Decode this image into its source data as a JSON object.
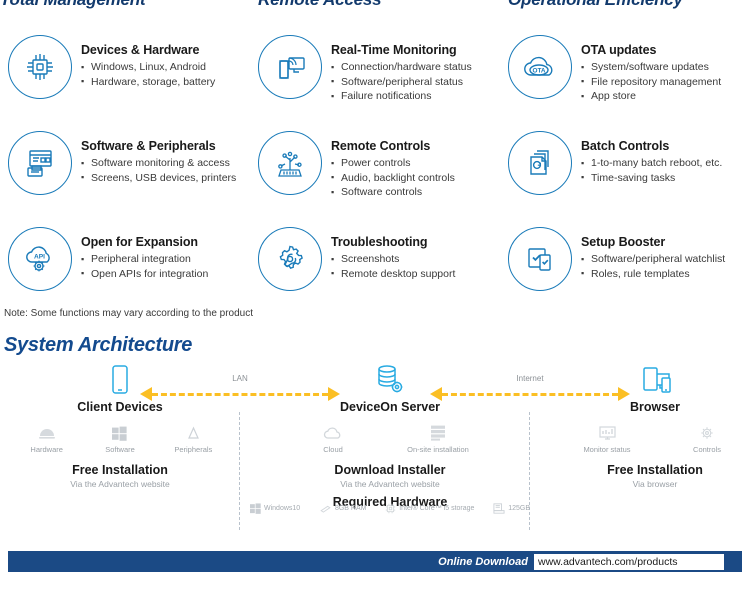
{
  "headers": {
    "col1": "Total Management",
    "col2": "Remote Access",
    "col3": "Operational Efficiency"
  },
  "features": [
    {
      "icon": "cpu-chip-icon",
      "title": "Devices & Hardware",
      "bullets": [
        "Windows, Linux, Android",
        "Hardware, storage, battery"
      ]
    },
    {
      "icon": "real-time-monitor-icon",
      "title": "Real-Time Monitoring",
      "bullets": [
        "Connection/hardware status",
        "Software/peripheral status",
        "Failure notifications"
      ]
    },
    {
      "icon": "ota-cloud-icon",
      "title": "OTA updates",
      "bullets": [
        "System/software updates",
        "File repository management",
        "App store"
      ]
    },
    {
      "icon": "software-peripherals-icon",
      "title": "Software & Peripherals",
      "bullets": [
        "Software monitoring & access",
        "Screens, USB devices, printers"
      ]
    },
    {
      "icon": "remote-controls-circuit-icon",
      "title": "Remote Controls",
      "bullets": [
        "Power controls",
        "Audio, backlight controls",
        "Software controls"
      ]
    },
    {
      "icon": "batch-controls-stack-icon",
      "title": "Batch Controls",
      "bullets": [
        "1-to-many batch reboot, etc.",
        "Time-saving tasks"
      ]
    },
    {
      "icon": "api-cloud-gear-icon",
      "title": "Open for Expansion",
      "bullets": [
        "Peripheral integration",
        "Open APIs for integration"
      ]
    },
    {
      "icon": "gear-wrench-icon",
      "title": "Troubleshooting",
      "bullets": [
        "Screenshots",
        "Remote desktop support"
      ]
    },
    {
      "icon": "setup-booster-check-icon",
      "title": "Setup Booster",
      "bullets": [
        "Software/peripheral watchlist",
        "Roles, rule templates"
      ]
    }
  ],
  "note": "Note: Some functions may vary according to the product",
  "architecture": {
    "title": "System Architecture",
    "arrows": {
      "lan": "LAN",
      "internet": "Internet"
    },
    "nodes": [
      {
        "id": "client-devices",
        "icon": "tablet-device-icon",
        "title": "Client Devices",
        "sub": [
          {
            "icon": "android-hardware-icon",
            "label": "Hardware"
          },
          {
            "icon": "windows-software-icon",
            "label": "Software"
          },
          {
            "icon": "peripherals-drop-icon",
            "label": "Peripherals"
          }
        ],
        "block_label": "Free Installation",
        "block_sub": "Via the Advantech website"
      },
      {
        "id": "deviceon-server",
        "icon": "database-gear-icon",
        "title": "DeviceOn Server",
        "sub": [
          {
            "icon": "cloud-icon",
            "label": "Cloud"
          },
          {
            "icon": "onsite-server-icon",
            "label": "On-site installation"
          }
        ],
        "block_label": "Download Installer",
        "block_sub": "Via the Advantech website",
        "hardware_label": "Required Hardware",
        "hardware": [
          {
            "icon": "windows-icon",
            "label": "Windows10"
          },
          {
            "icon": "ram-stick-icon",
            "label": "8GB RAM"
          },
          {
            "icon": "cpu-icon",
            "label": "Intel® Core™ i5 storage"
          },
          {
            "icon": "storage-disk-icon",
            "label": "125GB"
          }
        ]
      },
      {
        "id": "browser",
        "icon": "multi-device-browser-icon",
        "title": "Browser",
        "sub": [
          {
            "icon": "monitor-status-icon",
            "label": "Monitor status"
          },
          {
            "icon": "controls-gear-icon",
            "label": "Controls"
          }
        ],
        "block_label": "Free Installation",
        "block_sub": "Via browser"
      }
    ]
  },
  "footer": {
    "label": "Online Download",
    "url": "www.advantech.com/products"
  },
  "colors": {
    "brand_blue": "#1a7bb9",
    "header_navy": "#123a6d",
    "arch_title": "#134a8e",
    "arrow_yellow": "#fbbf24",
    "footer_bar": "#1b4a85"
  }
}
